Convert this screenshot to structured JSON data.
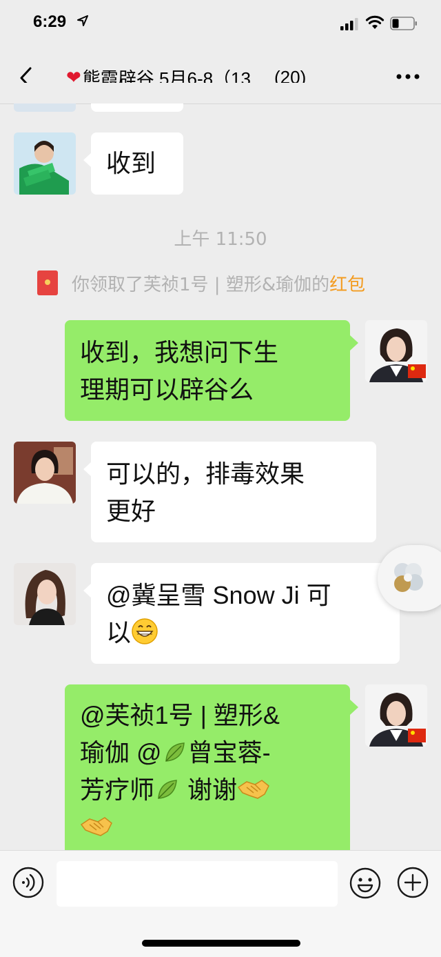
{
  "status_bar": {
    "time": "6:29"
  },
  "nav": {
    "title": "熊霞辟谷 5月6-8（13…",
    "member_count": "(20)"
  },
  "messages": [
    {
      "side": "left",
      "text": "收到"
    },
    {
      "side": "right",
      "lines": [
        "收到，我想问下生",
        "理期可以辟谷么"
      ]
    },
    {
      "side": "left",
      "lines": [
        "可以的，排毒效果",
        "更好"
      ]
    },
    {
      "side": "left",
      "lines": [
        "@冀呈雪 Snow Ji 可",
        "以"
      ],
      "emoji": "grinning-face"
    },
    {
      "side": "right",
      "lines": [
        "@芙祯1号 | 塑形&",
        "瑜伽 @",
        "曾宝蓉-",
        "芳疗师",
        "谢谢"
      ],
      "emoji": [
        "herb",
        "handshake"
      ]
    }
  ],
  "timestamp": "上午 11:50",
  "system_message": {
    "text": "你领取了芙祯1号 | 塑形&瑜伽的",
    "link": "红包"
  },
  "input": {
    "placeholder": ""
  },
  "colors": {
    "background": "#ededed",
    "green_bubble": "#95ec69",
    "link": "#f39c21"
  }
}
